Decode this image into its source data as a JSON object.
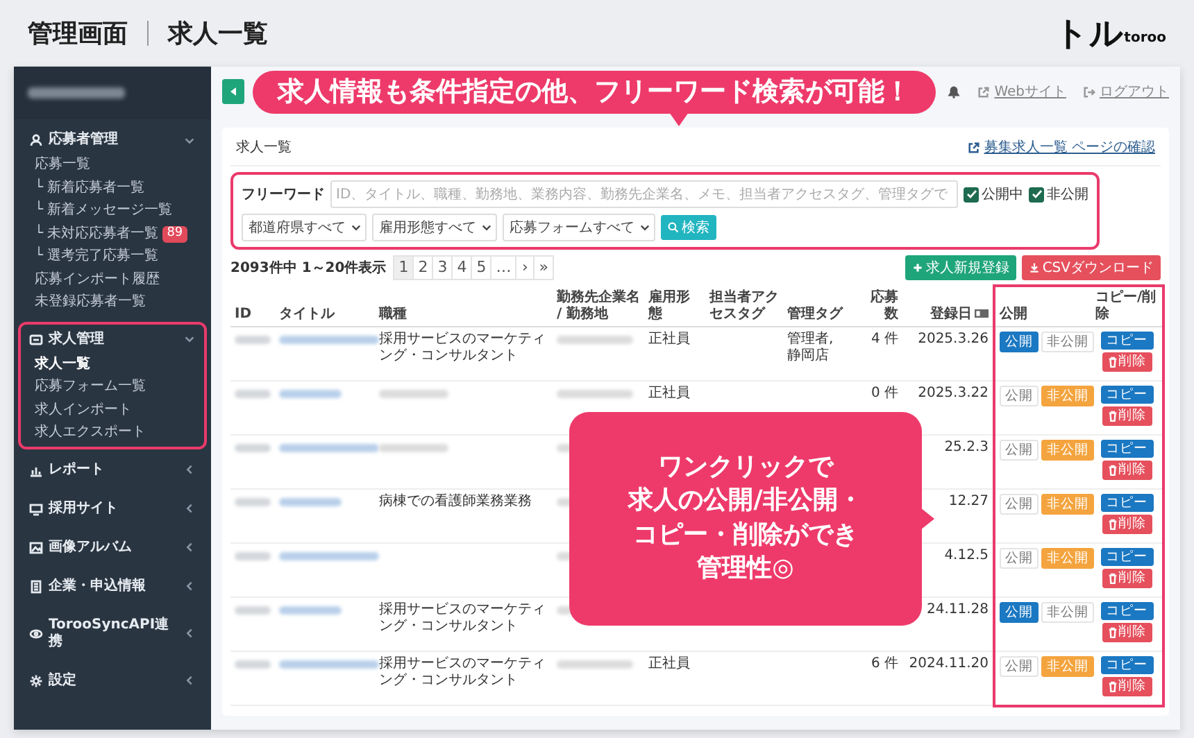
{
  "header": {
    "title": "管理画面",
    "subtitle": "求人一覧",
    "logo": {
      "mark": "トル",
      "text": "toroo"
    }
  },
  "sidebar": {
    "sections": [
      {
        "label": "応募者管理",
        "expanded": true,
        "highlighted": false,
        "items": [
          {
            "label": "応募一覧",
            "selected": false
          },
          {
            "label": "└ 新着応募者一覧",
            "selected": false
          },
          {
            "label": "└ 新着メッセージ一覧",
            "selected": false
          },
          {
            "label": "└ 未対応応募者一覧",
            "selected": false,
            "badge": "89"
          },
          {
            "label": "└ 選考完了応募一覧",
            "selected": false
          },
          {
            "label": "応募インポート履歴",
            "selected": false
          },
          {
            "label": "未登録応募者一覧",
            "selected": false
          }
        ]
      },
      {
        "label": "求人管理",
        "expanded": true,
        "highlighted": true,
        "items": [
          {
            "label": "求人一覧",
            "selected": true
          },
          {
            "label": "応募フォーム一覧",
            "selected": false
          },
          {
            "label": "求人インポート",
            "selected": false
          },
          {
            "label": "求人エクスポート",
            "selected": false
          }
        ]
      },
      {
        "label": "レポート",
        "expanded": false,
        "highlighted": false
      },
      {
        "label": "採用サイト",
        "expanded": false,
        "highlighted": false
      },
      {
        "label": "画像アルバム",
        "expanded": false,
        "highlighted": false
      },
      {
        "label": "企業・申込情報",
        "expanded": false,
        "highlighted": false
      },
      {
        "label": "TorooSyncAPI連携",
        "expanded": false,
        "highlighted": false
      },
      {
        "label": "設定",
        "expanded": false,
        "highlighted": false
      }
    ]
  },
  "topbar": {
    "links": [
      "Webサイト",
      "ログアウト"
    ]
  },
  "callouts": [
    {
      "lines": [
        "求人情報も条件指定の他、フリーワード検索が可能！"
      ]
    },
    {
      "lines": [
        "ワンクリックで",
        "求人の公開/非公開・",
        "コピー・削除ができ",
        "管理性◎"
      ]
    }
  ],
  "card": {
    "title": "求人一覧",
    "page_link": "募集求人一覧 ページの確認",
    "filter": {
      "label": "フリーワード",
      "placeholder": "ID、タイトル、職種、勤務地、業務内容、勤務先企業名、メモ、担当者アクセスタグ、管理タグで",
      "checkboxes": [
        {
          "label": "公開中",
          "checked": true
        },
        {
          "label": "非公開",
          "checked": true
        }
      ],
      "selects": [
        "都道府県すべて",
        "雇用形態すべて",
        "応募フォームすべて"
      ],
      "search_button": "検索"
    },
    "result_count": "2093件中 1～20件表示",
    "pagination": [
      {
        "label": "1",
        "selected": true
      },
      {
        "label": "2",
        "selected": false
      },
      {
        "label": "3",
        "selected": false
      },
      {
        "label": "4",
        "selected": false
      },
      {
        "label": "5",
        "selected": false
      },
      {
        "label": "…",
        "selected": false
      },
      {
        "label": "›",
        "selected": false
      },
      {
        "label": "»",
        "selected": false
      }
    ],
    "actions": [
      {
        "label": "求人新規登録",
        "kind": "create"
      },
      {
        "label": "CSVダウンロード",
        "kind": "download"
      }
    ],
    "table": {
      "columns": [
        {
          "label": "ID"
        },
        {
          "label": "タイトル"
        },
        {
          "label": "職種"
        },
        {
          "label": "勤務先企業名 / 勤務地"
        },
        {
          "label": "雇用形態"
        },
        {
          "label": "担当者アクセスタグ"
        },
        {
          "label": "管理タグ"
        },
        {
          "label": "応募数"
        },
        {
          "label": "登録日",
          "sortable": true
        },
        {
          "label": "公開"
        },
        {
          "label": "コピー/削除"
        }
      ],
      "rows": [
        {
          "job": "採用サービスのマーケティング・コンサルタント",
          "job_redacted": false,
          "employment": "正社員",
          "tags": "管理者, 静岡店",
          "applications": "4 件",
          "date": "2025.3.26",
          "toggle": [
            {
              "label": "公開",
              "selected": true
            },
            {
              "label": "非公開",
              "selected": false
            }
          ],
          "copy": "コピー",
          "delete": "削除"
        },
        {
          "job_redacted": true,
          "employment": "正社員",
          "applications": "0 件",
          "date": "2025.3.22",
          "toggle": [
            {
              "label": "公開",
              "selected": false
            },
            {
              "label": "非公開",
              "selected": true
            }
          ],
          "copy": "コピー",
          "delete": "削除"
        },
        {
          "job_redacted": true,
          "date": "25.2.3",
          "toggle": [
            {
              "label": "公開",
              "selected": false
            },
            {
              "label": "非公開",
              "selected": true
            }
          ],
          "copy": "コピー",
          "delete": "削除"
        },
        {
          "job": "病棟での看護師業務業務",
          "job_redacted": false,
          "date": "12.27",
          "toggle": [
            {
              "label": "公開",
              "selected": false
            },
            {
              "label": "非公開",
              "selected": true
            }
          ],
          "copy": "コピー",
          "delete": "削除"
        },
        {
          "date": "4.12.5",
          "toggle": [
            {
              "label": "公開",
              "selected": false
            },
            {
              "label": "非公開",
              "selected": true
            }
          ],
          "copy": "コピー",
          "delete": "削除"
        },
        {
          "job": "採用サービスのマーケティング・コンサルタント",
          "job_redacted": false,
          "date": "24.11.28",
          "toggle": [
            {
              "label": "公開",
              "selected": true
            },
            {
              "label": "非公開",
              "selected": false
            }
          ],
          "copy": "コピー",
          "delete": "削除"
        },
        {
          "job": "採用サービスのマーケティング・コンサルタント",
          "job_redacted": false,
          "employment": "正社員",
          "applications": "6 件",
          "date": "2024.11.20",
          "toggle": [
            {
              "label": "公開",
              "selected": false
            },
            {
              "label": "非公開",
              "selected": true
            }
          ],
          "copy": "コピー",
          "delete": "削除"
        }
      ]
    }
  }
}
